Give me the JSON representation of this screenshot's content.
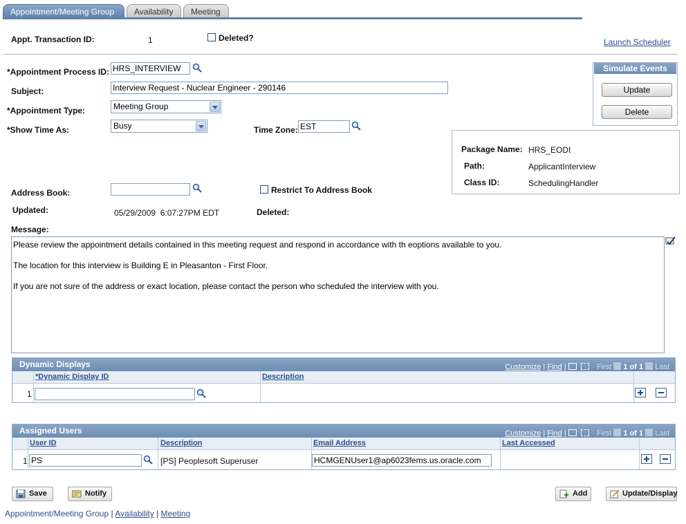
{
  "tabs": [
    {
      "label": "Appointment/Meeting Group"
    },
    {
      "label": "Availability"
    },
    {
      "label": "Meeting"
    }
  ],
  "header": {
    "appt_transaction_id_label": "Appt. Transaction ID:",
    "appt_transaction_id_value": "1",
    "deleted_label": "Deleted?",
    "launch_scheduler": "Launch Scheduler"
  },
  "form": {
    "appointment_process_id_label": "*Appointment Process ID:",
    "appointment_process_id_value": "HRS_INTERVIEW",
    "subject_label": "Subject:",
    "subject_value": "Interview Request - Nuclear Engineer - 290146",
    "appointment_type_label": "*Appointment Type:",
    "appointment_type_value": "Meeting Group",
    "show_time_as_label": "*Show Time As:",
    "show_time_as_value": "Busy",
    "time_zone_label": "Time Zone:",
    "time_zone_value": "EST",
    "address_book_label": "Address Book:",
    "address_book_value": "",
    "restrict_label": "Restrict To Address Book",
    "updated_label": "Updated:",
    "updated_value": "05/29/2009  6:07:27PM EDT",
    "deleted_label": "Deleted:",
    "message_label": "Message:",
    "message_lines": [
      "Please review the appointment details contained in this meeting request and respond in accordance with th eoptions available to you.",
      "The location for this interview is Building E in Pleasanton - First Floor.",
      "If you are not sure of the address or exact location, please contact the person who scheduled the interview with you."
    ]
  },
  "simulate_events": {
    "title": "Simulate Events",
    "update": "Update",
    "delete": "Delete"
  },
  "package_info": {
    "package_name_label": "Package Name:",
    "package_name_value": "HRS_EODI",
    "path_label": "Path:",
    "path_value": "ApplicantInterview",
    "class_id_label": "Class ID:",
    "class_id_value": "SchedulingHandler"
  },
  "grid_nav": {
    "customize": "Customize",
    "find": "Find",
    "first": "First",
    "count": "1 of 1",
    "last": "Last"
  },
  "dynamic_displays": {
    "title": "Dynamic Displays",
    "col_id": "*Dynamic Display ID",
    "col_desc": "Description",
    "row_num": "1",
    "row_id_value": ""
  },
  "assigned_users": {
    "title": "Assigned Users",
    "col_user": "User ID",
    "col_desc": "Description",
    "col_email": "Email Address",
    "col_last": "Last Accessed",
    "row_num": "1",
    "user_value": "PS",
    "desc_value": "[PS] Peoplesoft Superuser",
    "email_value": "HCMGENUser1@ap6023fems.us.oracle.com"
  },
  "toolbar": {
    "save": "Save",
    "notify": "Notify",
    "add": "Add",
    "update_display": "Update/Display"
  },
  "footer_links": [
    {
      "label": "Appointment/Meeting Group"
    },
    {
      "label": "Availability"
    },
    {
      "label": "Meeting"
    }
  ],
  "icons": {
    "lookup": "magnifier-icon",
    "spell": "spellcheck-icon",
    "grid_view": "view-all-icon",
    "download": "download-icon"
  }
}
